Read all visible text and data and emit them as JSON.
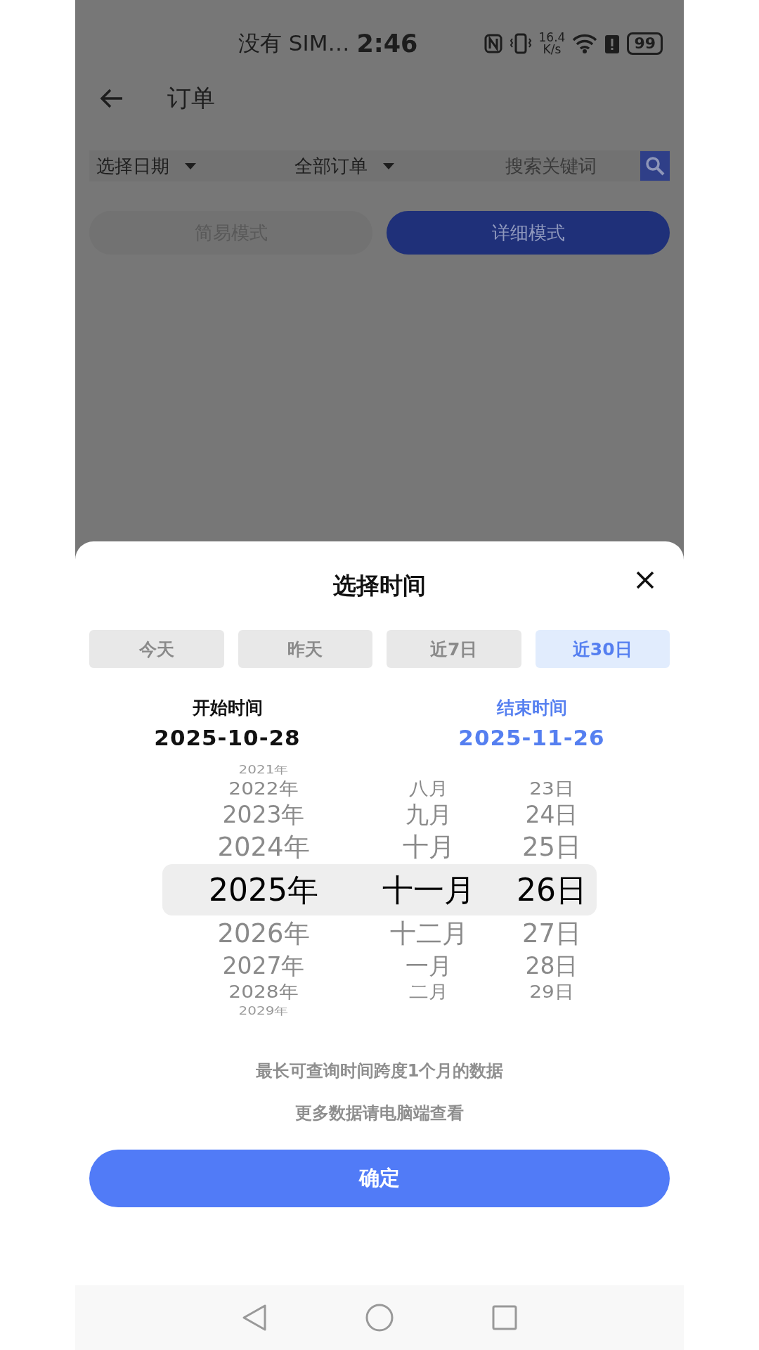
{
  "status_bar": {
    "carrier": "没有 SIM…",
    "time": "2:46",
    "speed_value": "16.4",
    "speed_unit": "K/s",
    "battery": "99"
  },
  "header": {
    "title": "订单"
  },
  "filters": [
    {
      "label": "选择日期"
    },
    {
      "label": "全部订单"
    }
  ],
  "search": {
    "placeholder": "搜索关键词"
  },
  "modes": [
    {
      "label": "简易模式",
      "selected": false
    },
    {
      "label": "详细模式",
      "selected": true
    }
  ],
  "sheet": {
    "title": "选择时间",
    "presets": [
      {
        "label": "今天",
        "selected": false
      },
      {
        "label": "昨天",
        "selected": false
      },
      {
        "label": "近7日",
        "selected": false
      },
      {
        "label": "近30日",
        "selected": true
      }
    ],
    "range": [
      {
        "label": "开始时间",
        "value": "2025-10-28",
        "selected": false
      },
      {
        "label": "结束时间",
        "value": "2025-11-26",
        "selected": true
      }
    ],
    "picker": [
      {
        "items": [
          {
            "label": "2021年",
            "selected": false
          },
          {
            "label": "2022年",
            "selected": false
          },
          {
            "label": "2023年",
            "selected": false
          },
          {
            "label": "2024年",
            "selected": false
          },
          {
            "label": "2025年",
            "selected": true
          },
          {
            "label": "2026年",
            "selected": false
          },
          {
            "label": "2027年",
            "selected": false
          },
          {
            "label": "2028年",
            "selected": false
          },
          {
            "label": "2029年",
            "selected": false
          }
        ]
      },
      {
        "items": [
          {
            "label": "八月",
            "selected": false
          },
          {
            "label": "九月",
            "selected": false
          },
          {
            "label": "十月",
            "selected": false
          },
          {
            "label": "十一月",
            "selected": true
          },
          {
            "label": "十二月",
            "selected": false
          },
          {
            "label": "一月",
            "selected": false
          },
          {
            "label": "二月",
            "selected": false
          }
        ]
      },
      {
        "items": [
          {
            "label": "23日",
            "selected": false
          },
          {
            "label": "24日",
            "selected": false
          },
          {
            "label": "25日",
            "selected": false
          },
          {
            "label": "26日",
            "selected": true
          },
          {
            "label": "27日",
            "selected": false
          },
          {
            "label": "28日",
            "selected": false
          },
          {
            "label": "29日",
            "selected": false
          }
        ]
      }
    ],
    "notes": [
      "最长可查询时间跨度1个月的数据",
      "更多数据请电脑端查看"
    ],
    "confirm": "确定"
  }
}
